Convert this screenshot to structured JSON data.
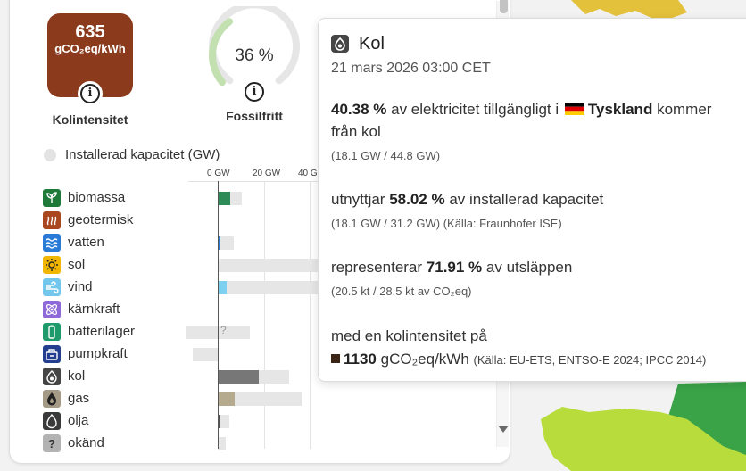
{
  "carbon_intensity": {
    "value": "635",
    "unit": "gCO₂eq/kWh",
    "label": "Kolintensitet",
    "color": "#8b3a1c"
  },
  "fossil_free": {
    "value": "36 %",
    "label": "Fossilfritt",
    "fraction": 0.36,
    "arc_color": "#c3e0b0",
    "track_color": "#e6e6e6"
  },
  "capacity_legend": {
    "label": "Installerad kapacitet (GW)"
  },
  "axis": {
    "ticks": [
      "0 GW",
      "20 GW",
      "40 G"
    ]
  },
  "sources": [
    {
      "name": "biomassa",
      "icon": "sprout-icon",
      "icon_color": "#1f7a3a",
      "bar_color": "#2e8b57",
      "production_gw": 5.5,
      "capacity_gw": 10.5
    },
    {
      "name": "geotermisk",
      "icon": "heat-icon",
      "icon_color": "#a9471f",
      "bar_color": "#a9471f",
      "production_gw": 0,
      "capacity_gw": 0
    },
    {
      "name": "vatten",
      "icon": "water-icon",
      "icon_color": "#2a7bd8",
      "bar_color": "#2a7bd8",
      "production_gw": 1.2,
      "capacity_gw": 7
    },
    {
      "name": "sol",
      "icon": "sun-icon",
      "icon_color": "#f2b600",
      "bar_color": "#f2b600",
      "production_gw": 0,
      "capacity_gw": 50
    },
    {
      "name": "vind",
      "icon": "wind-icon",
      "icon_color": "#74c7ec",
      "bar_color": "#7dd0f0",
      "production_gw": 4,
      "capacity_gw": 50
    },
    {
      "name": "kärnkraft",
      "icon": "atom-icon",
      "icon_color": "#8e6ad8",
      "bar_color": "#8e6ad8",
      "production_gw": 0,
      "capacity_gw": 0
    },
    {
      "name": "batterilager",
      "icon": "battery-icon",
      "icon_color": "#1f9a6b",
      "bar_color": "#1f9a6b",
      "production_gw": 0,
      "capacity_gw": 14,
      "capacity_min_gw": -14,
      "unknown_mark": "?"
    },
    {
      "name": "pumpkraft",
      "icon": "pump-icon",
      "icon_color": "#243f8f",
      "bar_color": "#243f8f",
      "production_gw": 0,
      "capacity_gw": 0,
      "capacity_min_gw": -11
    },
    {
      "name": "kol",
      "icon": "coal-icon",
      "icon_color": "#454545",
      "bar_color": "#777777",
      "production_gw": 18.1,
      "capacity_gw": 31.2
    },
    {
      "name": "gas",
      "icon": "gas-icon",
      "icon_color": "#a59a86",
      "bar_color": "#b5a98e",
      "production_gw": 7.5,
      "capacity_gw": 37
    },
    {
      "name": "olja",
      "icon": "oil-icon",
      "icon_color": "#3a3a3a",
      "bar_color": "#555555",
      "production_gw": 0.4,
      "capacity_gw": 5
    },
    {
      "name": "okänd",
      "icon": "question-icon",
      "icon_color": "#b3b3b3",
      "bar_color": "#999999",
      "production_gw": 0,
      "capacity_gw": 3.5,
      "icon_glyph": "?"
    }
  ],
  "tooltip": {
    "title": "Kol",
    "date": "21 mars 2026 03:00 CET",
    "share_pct": "40.38 %",
    "share_text": "av elektricitet tillgängligt i",
    "country": "Tyskland",
    "share_text_end": "kommer",
    "share_text_line2": "från kol",
    "share_detail": "(18.1 GW / 44.8 GW)",
    "util_text": "utnyttjar",
    "util_pct": "58.02 %",
    "util_text_end": "av installerad kapacitet",
    "util_detail": "(18.1 GW / 31.2 GW) (Källa: Fraunhofer ISE)",
    "emis_text": "representerar",
    "emis_pct": "71.91 %",
    "emis_text_end": "av utsläppen",
    "emis_detail": "(20.5 kt / 28.5 kt av CO₂eq)",
    "ci_text": "med en kolintensitet på",
    "ci_value": "1130",
    "ci_unit": "gCO₂eq/kWh",
    "ci_source": "(Källa: EU-ETS, ENTSO-E 2024; IPCC 2014)"
  },
  "map_colors": {
    "water": "#f2f2f2",
    "yellow_country": "#e3c13a",
    "green_country": "#3aa348",
    "light_green_country": "#b8dc3c"
  }
}
